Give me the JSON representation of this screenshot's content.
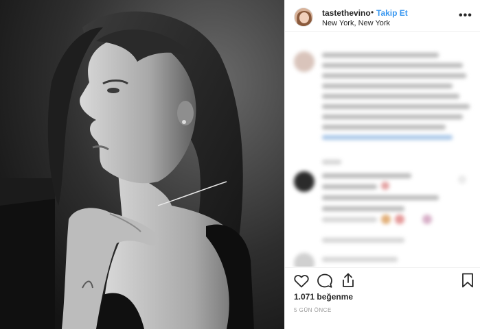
{
  "header": {
    "username": "tastethevino",
    "separator": "•",
    "follow_label": "Takip Et",
    "location": "New York, New York",
    "more_label": "•••",
    "avatar_icon": "profile-avatar"
  },
  "actions": {
    "like_icon": "heart-icon",
    "comment_icon": "comment-icon",
    "share_icon": "share-icon",
    "save_icon": "bookmark-icon"
  },
  "stats": {
    "likes": "1.071 beğenme",
    "time_ago": "5 GÜN ÖNCE"
  },
  "colors": {
    "accent": "#3897f0",
    "text": "#262626",
    "muted": "#999999",
    "border": "#efefef"
  }
}
